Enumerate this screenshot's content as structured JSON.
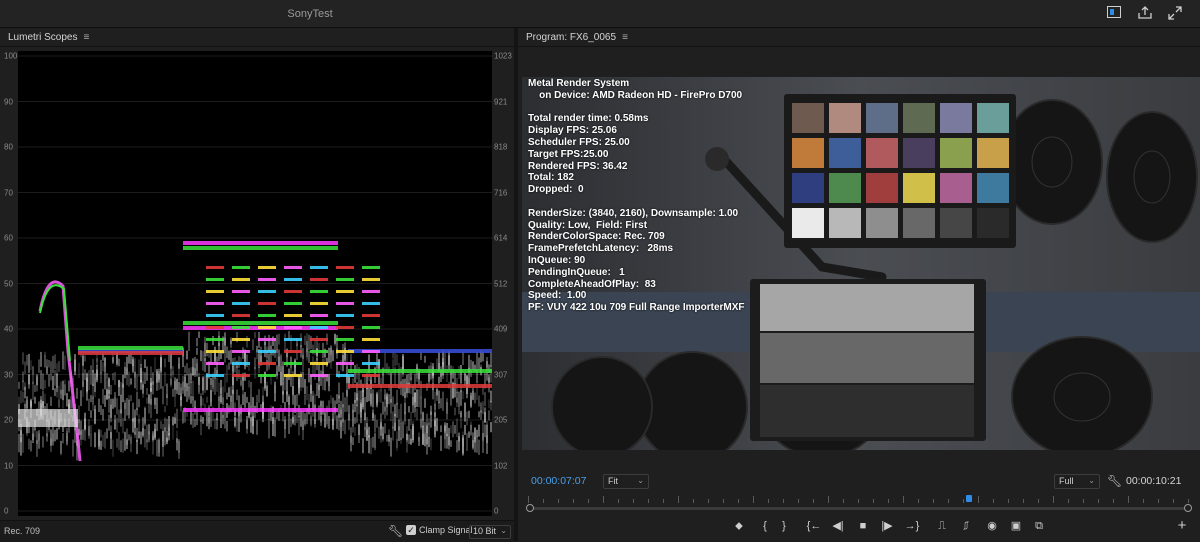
{
  "window": {
    "title": "SonyTest"
  },
  "titlebar_icons": [
    "workspace-icon",
    "export-icon",
    "fullscreen-icon"
  ],
  "scopes": {
    "tab_label": "Lumetri Scopes",
    "menu_icon": "hamburger-menu-icon",
    "left_axis": [
      "100",
      "90",
      "80",
      "70",
      "60",
      "50",
      "40",
      "30",
      "20",
      "10",
      "0"
    ],
    "right_axis": [
      "1023",
      "921",
      "818",
      "716",
      "614",
      "512",
      "409",
      "307",
      "205",
      "102",
      "0"
    ],
    "footer": {
      "color_space": "Rec. 709",
      "clamp_label": "Clamp Signal",
      "clamp_checked": true,
      "bit_depth": "10 Bit"
    }
  },
  "program": {
    "tab_label": "Program: FX6_0065",
    "menu_icon": "hamburger-menu-icon",
    "overlay_lines": [
      "Metal Render System",
      "    on Device: AMD Radeon HD - FirePro D700",
      "",
      "Total render time: 0.58ms",
      "Display FPS: 25.06",
      "Scheduler FPS: 25.00",
      "Target FPS:25.00",
      "Rendered FPS: 36.42",
      "Total: 182",
      "Dropped:  0",
      "",
      "RenderSize: (3840, 2160), Downsample: 1.00",
      "Quality: Low,  Field: First",
      "RenderColorSpace: Rec. 709",
      "FramePrefetchLatency:   28ms",
      "InQueue: 90",
      "PendingInQueue:   1",
      "CompleteAheadOfPlay:  83",
      "Speed:  1.00",
      "PF: VUY 422 10u 709 Full Range ImporterMXF"
    ],
    "current_timecode": "00:00:07:07",
    "total_timecode": "00:00:10:21",
    "zoom": "Fit",
    "resolution": "Full",
    "playhead_fraction": 0.66,
    "accent_color": "#2e8ce6",
    "transport": [
      {
        "name": "add-marker-icon",
        "glyph": "⬥"
      },
      {
        "name": "mark-in-icon",
        "glyph": "{"
      },
      {
        "name": "mark-out-icon",
        "glyph": "}"
      },
      {
        "name": "go-to-in-icon",
        "glyph": "{←"
      },
      {
        "name": "step-back-icon",
        "glyph": "◀|"
      },
      {
        "name": "stop-icon",
        "glyph": "■"
      },
      {
        "name": "step-forward-icon",
        "glyph": "|▶"
      },
      {
        "name": "go-to-out-icon",
        "glyph": "→}"
      },
      {
        "name": "lift-icon",
        "glyph": "⎍"
      },
      {
        "name": "extract-icon",
        "glyph": "⎎"
      },
      {
        "name": "export-frame-icon",
        "glyph": "◉"
      },
      {
        "name": "comparison-view-icon",
        "glyph": "▣"
      },
      {
        "name": "proxy-toggle-icon",
        "glyph": "⧉"
      },
      {
        "name": "add-button-icon",
        "glyph": "+"
      }
    ]
  },
  "colors": {
    "chart_patches": [
      "#6e5a4e",
      "#b08a7e",
      "#5e6e88",
      "#5e6a52",
      "#7a7a9e",
      "#6a9e9a",
      "#c07a3a",
      "#3e5e9a",
      "#b05a5e",
      "#4a3e5e",
      "#8aa04e",
      "#c8a04a",
      "#2e3e7e",
      "#4e8a4e",
      "#a03e3e",
      "#d0c04a",
      "#a85e8e",
      "#3e7a9e",
      "#eaeaea",
      "#b8b8b8",
      "#8e8e8e",
      "#686868",
      "#464646",
      "#2a2a2a"
    ]
  }
}
